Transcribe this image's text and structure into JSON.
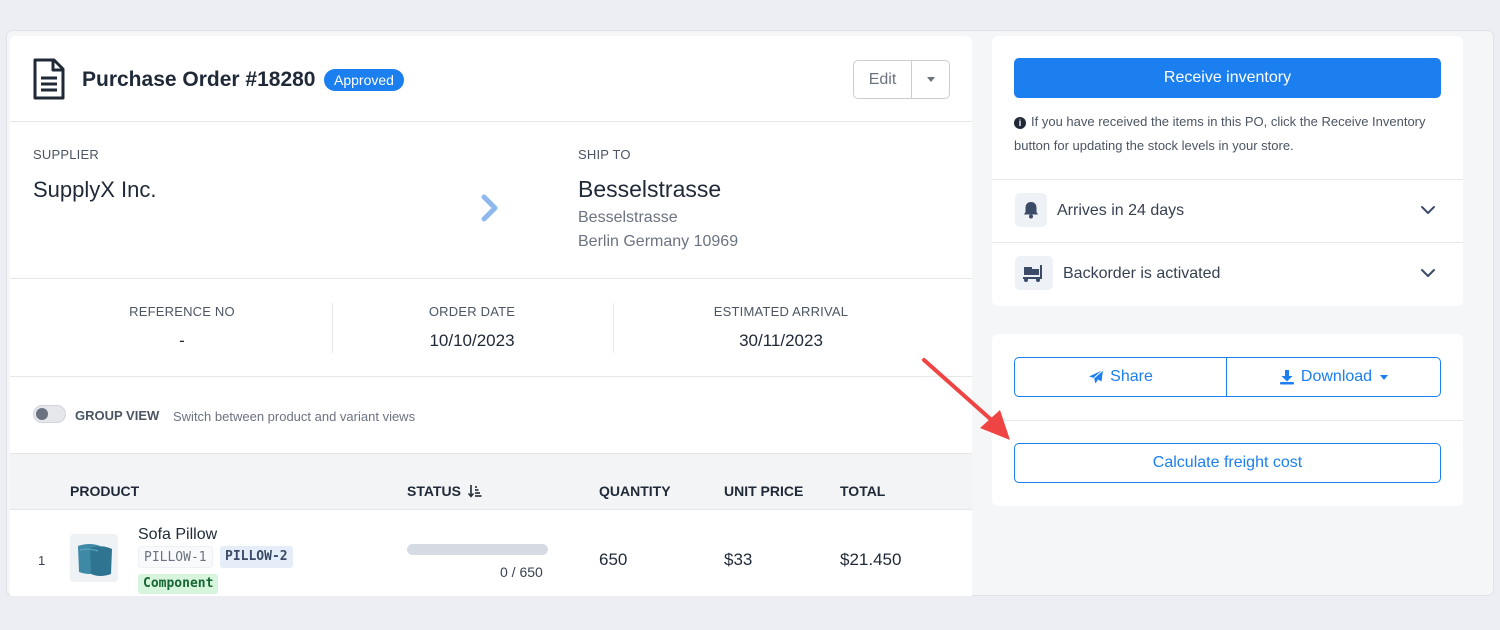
{
  "po": {
    "title": "Purchase Order #18280",
    "status_badge": "Approved",
    "edit_label": "Edit"
  },
  "supplier": {
    "label": "SUPPLIER",
    "name": "SupplyX Inc."
  },
  "ship_to": {
    "label": "SHIP TO",
    "name": "Besselstrasse",
    "line1": "Besselstrasse",
    "line2": "Berlin Germany 10969"
  },
  "meta": {
    "reference_label": "REFERENCE NO",
    "reference_value": "-",
    "order_date_label": "ORDER DATE",
    "order_date_value": "10/10/2023",
    "arrival_label": "ESTIMATED ARRIVAL",
    "arrival_value": "30/11/2023"
  },
  "group_view": {
    "label": "GROUP VIEW",
    "description": "Switch between product and variant views",
    "enabled": false
  },
  "table": {
    "headers": {
      "product": "PRODUCT",
      "status": "STATUS",
      "quantity": "QUANTITY",
      "unit_price": "UNIT PRICE",
      "total": "TOTAL"
    },
    "rows": [
      {
        "index": "1",
        "product_name": "Sofa Pillow",
        "sku_1": "PILLOW-1",
        "sku_2": "PILLOW-2",
        "tag": "Component",
        "received_text": "0 / 650",
        "received_fraction": 0,
        "quantity": "650",
        "unit_price": "$33",
        "total": "$21.450"
      }
    ]
  },
  "receive": {
    "button_label": "Receive inventory",
    "info_text": "If you have received the items in this PO, click the Receive Inventory button for updating the stock levels in your store."
  },
  "accordions": {
    "arrival_label": "Arrives in 24 days",
    "backorder_label": "Backorder is activated"
  },
  "actions": {
    "share_label": "Share",
    "download_label": "Download",
    "freight_label": "Calculate freight cost"
  },
  "colors": {
    "accent": "#1b7ff0",
    "annotation_arrow": "#ef4444",
    "component_tag_bg": "#d7f5dd"
  }
}
